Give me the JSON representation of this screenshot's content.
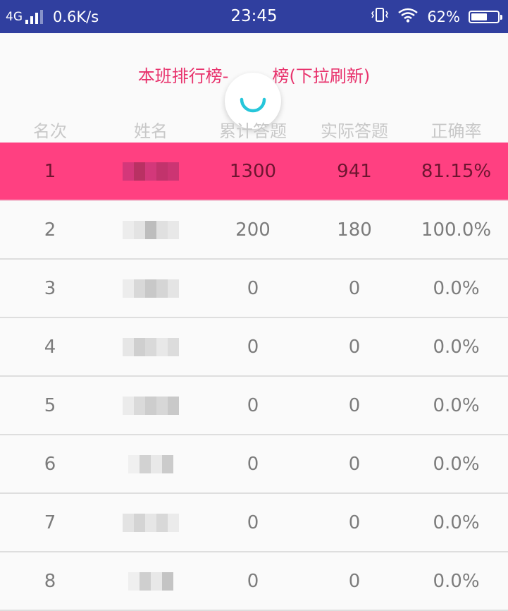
{
  "status_bar": {
    "network": "4G",
    "speed": "0.6K/s",
    "time": "23:45",
    "battery": "62%",
    "battery_level": 0.62
  },
  "title": "本班排行榜-",
  "title_after": "榜(下拉刷新)",
  "columns": [
    "名次",
    "姓名",
    "累计答题",
    "实际答题",
    "正确率"
  ],
  "rows": [
    {
      "rank": "1",
      "total": "1300",
      "actual": "941",
      "rate": "81.15%"
    },
    {
      "rank": "2",
      "total": "200",
      "actual": "180",
      "rate": "100.0%"
    },
    {
      "rank": "3",
      "total": "0",
      "actual": "0",
      "rate": "0.0%"
    },
    {
      "rank": "4",
      "total": "0",
      "actual": "0",
      "rate": "0.0%"
    },
    {
      "rank": "5",
      "total": "0",
      "actual": "0",
      "rate": "0.0%"
    },
    {
      "rank": "6",
      "total": "0",
      "actual": "0",
      "rate": "0.0%"
    },
    {
      "rank": "7",
      "total": "0",
      "actual": "0",
      "rate": "0.0%"
    },
    {
      "rank": "8",
      "total": "0",
      "actual": "0",
      "rate": "0.0%"
    }
  ],
  "colors": {
    "status_bar": "#303f9f",
    "accent": "#ff4081",
    "title": "#e8336d",
    "spinner": "#26c6da"
  }
}
